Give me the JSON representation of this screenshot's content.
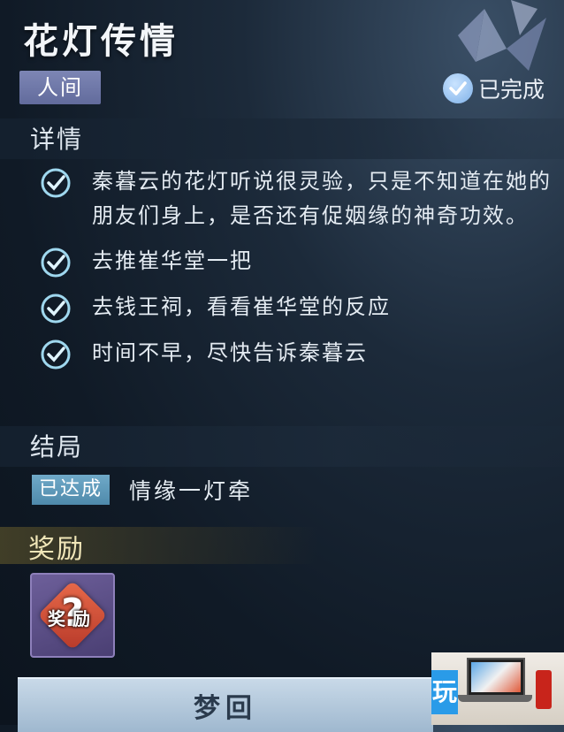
{
  "header": {
    "title": "花灯传情",
    "tag": "人间",
    "status": "已完成"
  },
  "details": {
    "heading": "详情",
    "tasks": [
      {
        "text": "秦暮云的花灯听说很灵验，只是不知道在她的朋友们身上，是否还有促姻缘的神奇功效。",
        "done": true
      },
      {
        "text": "去推崔华堂一把",
        "done": true
      },
      {
        "text": "去钱王祠，看看崔华堂的反应",
        "done": true
      },
      {
        "text": "时间不早，尽快告诉秦暮云",
        "done": true
      }
    ]
  },
  "ending": {
    "heading": "结局",
    "badge": "已达成",
    "name": "情缘一灯牵"
  },
  "reward": {
    "heading": "奖励",
    "item_label": "奖励",
    "item_mark": "?"
  },
  "action": {
    "dream_button": "梦回"
  },
  "watermark": {
    "logo_text": "玩"
  },
  "colors": {
    "tag_bg": "#6f78a8",
    "achieved_bg": "#5f9aba",
    "reward_heading": "#f0e6b8",
    "check_color": "#9fd8ef"
  }
}
